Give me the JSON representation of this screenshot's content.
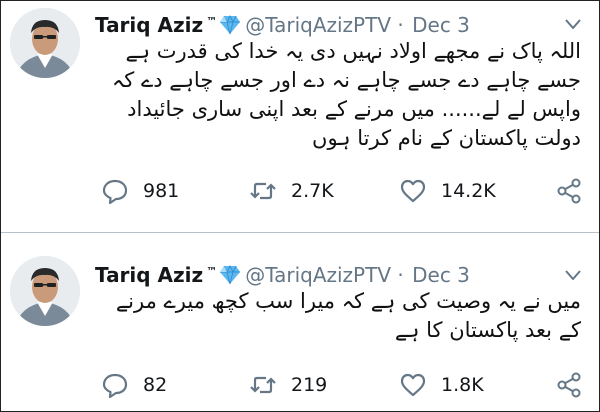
{
  "tweets": [
    {
      "name": "Tariq Aziz",
      "tm": "™",
      "handle": "@TariqAzizPTV",
      "sep": "·",
      "date": "Dec 3",
      "text": "اللہ پاک نے مجھے اولاد نہیں دی یہ خدا کی قدرت ہے جسے چاہے دے جسے چاہے نہ دے اور جسے چاہے دے کہ واپس لے لے...... میں مرنے کے بعد اپنی ساری جائیداد دولت پاکستان کے نام کرتا ہوں",
      "replies": "981",
      "retweets": "2.7K",
      "likes": "14.2K"
    },
    {
      "name": "Tariq Aziz",
      "tm": "™",
      "handle": "@TariqAzizPTV",
      "sep": "·",
      "date": "Dec 3",
      "text": "میں نے یہ وصیت کی ہے کہ میرا سب کچھ میرے مرنے کے بعد پاکستان کا ہے",
      "replies": "82",
      "retweets": "219",
      "likes": "1.8K"
    }
  ],
  "icons": {
    "verified": "diamond-emoji-icon",
    "reply": "speech-bubble-icon",
    "retweet": "retweet-arrows-icon",
    "like": "heart-icon",
    "share": "share-nodes-icon",
    "menu": "chevron-down-icon"
  },
  "colors": {
    "secondary_text": "#657786",
    "diamond": "#5db8f0"
  }
}
